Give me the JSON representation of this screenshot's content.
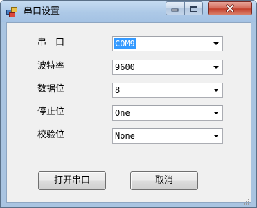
{
  "window": {
    "title": "串口设置",
    "icon": "app-window-icon"
  },
  "titlebar_buttons": {
    "minimize_icon": "minimize-icon",
    "maximize_icon": "maximize-icon",
    "close_icon": "close-icon"
  },
  "fields": [
    {
      "label": "串　口",
      "value": "COM9",
      "selected": true
    },
    {
      "label": "波特率",
      "value": "9600",
      "selected": false
    },
    {
      "label": "数据位",
      "value": "8",
      "selected": false
    },
    {
      "label": "停止位",
      "value": "One",
      "selected": false
    },
    {
      "label": "校验位",
      "value": "None",
      "selected": false
    }
  ],
  "buttons": {
    "open_label": "打开串口",
    "cancel_label": "取消"
  },
  "colors": {
    "selection": "#3399ff",
    "close_button": "#c4402c",
    "titlebar": "#adc9e7"
  }
}
